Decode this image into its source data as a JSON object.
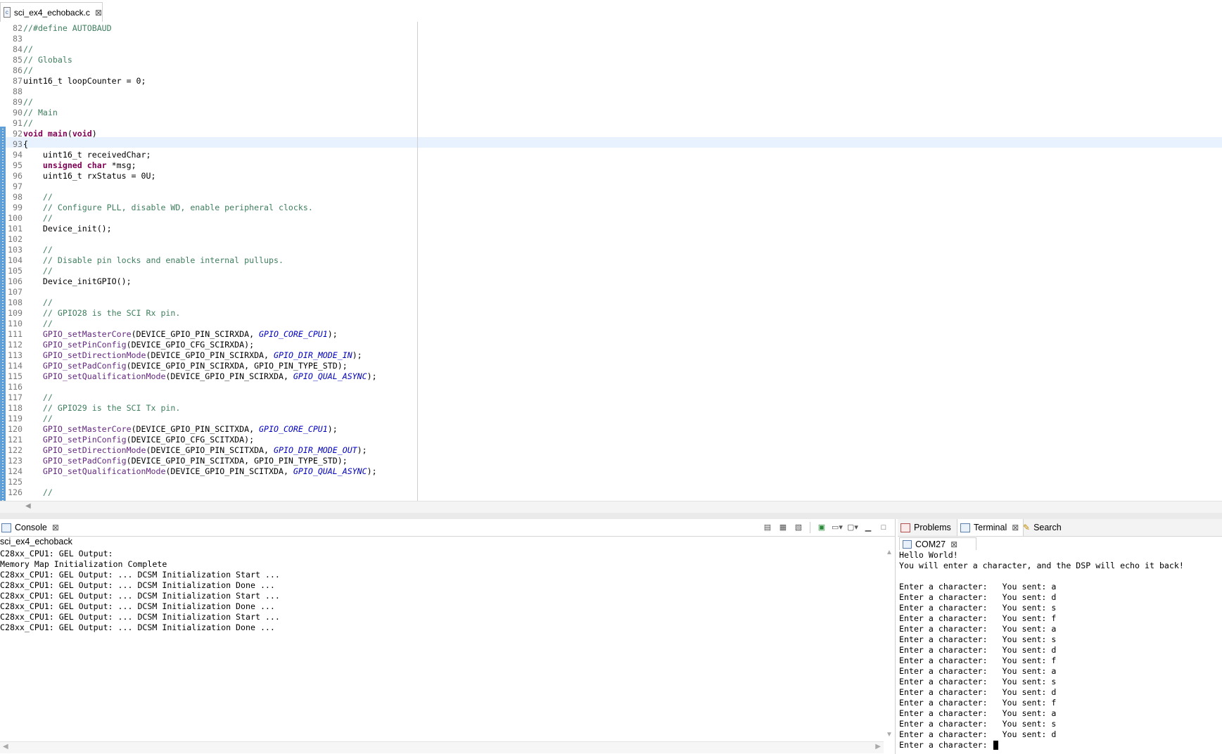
{
  "editor": {
    "tab": {
      "file_icon": "c-file-icon",
      "label": "sci_ex4_echoback.c",
      "close_glyph": "⊠"
    },
    "lines": [
      {
        "n": "82",
        "segs": [
          [
            "cm",
            "//#define AUTOBAUD"
          ]
        ]
      },
      {
        "n": "83",
        "segs": []
      },
      {
        "n": "84",
        "segs": [
          [
            "cm",
            "//"
          ]
        ]
      },
      {
        "n": "85",
        "segs": [
          [
            "cm",
            "// Globals"
          ]
        ]
      },
      {
        "n": "86",
        "segs": [
          [
            "cm",
            "//"
          ]
        ]
      },
      {
        "n": "87",
        "segs": [
          [
            "",
            "uint16_t loopCounter = 0;"
          ]
        ]
      },
      {
        "n": "88",
        "segs": []
      },
      {
        "n": "89",
        "segs": [
          [
            "cm",
            "//"
          ]
        ]
      },
      {
        "n": "90",
        "segs": [
          [
            "cm",
            "// Main"
          ]
        ]
      },
      {
        "n": "91",
        "segs": [
          [
            "cm",
            "//"
          ]
        ]
      },
      {
        "n": "92",
        "segs": [
          [
            "kw",
            "void"
          ],
          [
            "",
            " "
          ],
          [
            "kw",
            "main"
          ],
          [
            "",
            "("
          ],
          [
            "kw",
            "void"
          ],
          [
            "",
            ")"
          ]
        ]
      },
      {
        "n": "93",
        "segs": [
          [
            "",
            "{"
          ]
        ]
      },
      {
        "n": "94",
        "segs": [
          [
            "",
            "    uint16_t receivedChar;"
          ]
        ]
      },
      {
        "n": "95",
        "segs": [
          [
            "",
            "    "
          ],
          [
            "kw",
            "unsigned char"
          ],
          [
            "",
            " *msg;"
          ]
        ]
      },
      {
        "n": "96",
        "segs": [
          [
            "",
            "    uint16_t rxStatus = 0U;"
          ]
        ]
      },
      {
        "n": "97",
        "segs": []
      },
      {
        "n": "98",
        "segs": [
          [
            "",
            "    "
          ],
          [
            "cm",
            "//"
          ]
        ]
      },
      {
        "n": "99",
        "segs": [
          [
            "",
            "    "
          ],
          [
            "cm",
            "// Configure PLL, disable WD, enable peripheral clocks."
          ]
        ]
      },
      {
        "n": "100",
        "segs": [
          [
            "",
            "    "
          ],
          [
            "cm",
            "//"
          ]
        ]
      },
      {
        "n": "101",
        "segs": [
          [
            "",
            "    Device_init();"
          ]
        ]
      },
      {
        "n": "102",
        "segs": []
      },
      {
        "n": "103",
        "segs": [
          [
            "",
            "    "
          ],
          [
            "cm",
            "//"
          ]
        ]
      },
      {
        "n": "104",
        "segs": [
          [
            "",
            "    "
          ],
          [
            "cm",
            "// Disable pin locks and enable internal pullups."
          ]
        ]
      },
      {
        "n": "105",
        "segs": [
          [
            "",
            "    "
          ],
          [
            "cm",
            "//"
          ]
        ]
      },
      {
        "n": "106",
        "segs": [
          [
            "",
            "    Device_initGPIO();"
          ]
        ]
      },
      {
        "n": "107",
        "segs": []
      },
      {
        "n": "108",
        "segs": [
          [
            "",
            "    "
          ],
          [
            "cm",
            "//"
          ]
        ]
      },
      {
        "n": "109",
        "segs": [
          [
            "",
            "    "
          ],
          [
            "cm",
            "// GPIO28 is the SCI Rx pin."
          ]
        ]
      },
      {
        "n": "110",
        "segs": [
          [
            "",
            "    "
          ],
          [
            "cm",
            "//"
          ]
        ]
      },
      {
        "n": "111",
        "segs": [
          [
            "",
            "    "
          ],
          [
            "fn",
            "GPIO_setMasterCore"
          ],
          [
            "",
            "(DEVICE_GPIO_PIN_SCIRXDA, "
          ],
          [
            "en",
            "GPIO_CORE_CPU1"
          ],
          [
            "",
            ");"
          ]
        ]
      },
      {
        "n": "112",
        "segs": [
          [
            "",
            "    "
          ],
          [
            "fn",
            "GPIO_setPinConfig"
          ],
          [
            "",
            "(DEVICE_GPIO_CFG_SCIRXDA);"
          ]
        ]
      },
      {
        "n": "113",
        "segs": [
          [
            "",
            "    "
          ],
          [
            "fn",
            "GPIO_setDirectionMode"
          ],
          [
            "",
            "(DEVICE_GPIO_PIN_SCIRXDA, "
          ],
          [
            "en",
            "GPIO_DIR_MODE_IN"
          ],
          [
            "",
            ");"
          ]
        ]
      },
      {
        "n": "114",
        "segs": [
          [
            "",
            "    "
          ],
          [
            "fn",
            "GPIO_setPadConfig"
          ],
          [
            "",
            "(DEVICE_GPIO_PIN_SCIRXDA, GPIO_PIN_TYPE_STD);"
          ]
        ]
      },
      {
        "n": "115",
        "segs": [
          [
            "",
            "    "
          ],
          [
            "fn",
            "GPIO_setQualificationMode"
          ],
          [
            "",
            "(DEVICE_GPIO_PIN_SCIRXDA, "
          ],
          [
            "en",
            "GPIO_QUAL_ASYNC"
          ],
          [
            "",
            ");"
          ]
        ]
      },
      {
        "n": "116",
        "segs": []
      },
      {
        "n": "117",
        "segs": [
          [
            "",
            "    "
          ],
          [
            "cm",
            "//"
          ]
        ]
      },
      {
        "n": "118",
        "segs": [
          [
            "",
            "    "
          ],
          [
            "cm",
            "// GPIO29 is the SCI Tx pin."
          ]
        ]
      },
      {
        "n": "119",
        "segs": [
          [
            "",
            "    "
          ],
          [
            "cm",
            "//"
          ]
        ]
      },
      {
        "n": "120",
        "segs": [
          [
            "",
            "    "
          ],
          [
            "fn",
            "GPIO_setMasterCore"
          ],
          [
            "",
            "(DEVICE_GPIO_PIN_SCITXDA, "
          ],
          [
            "en",
            "GPIO_CORE_CPU1"
          ],
          [
            "",
            ");"
          ]
        ]
      },
      {
        "n": "121",
        "segs": [
          [
            "",
            "    "
          ],
          [
            "fn",
            "GPIO_setPinConfig"
          ],
          [
            "",
            "(DEVICE_GPIO_CFG_SCITXDA);"
          ]
        ]
      },
      {
        "n": "122",
        "segs": [
          [
            "",
            "    "
          ],
          [
            "fn",
            "GPIO_setDirectionMode"
          ],
          [
            "",
            "(DEVICE_GPIO_PIN_SCITXDA, "
          ],
          [
            "en",
            "GPIO_DIR_MODE_OUT"
          ],
          [
            "",
            ");"
          ]
        ]
      },
      {
        "n": "123",
        "segs": [
          [
            "",
            "    "
          ],
          [
            "fn",
            "GPIO_setPadConfig"
          ],
          [
            "",
            "(DEVICE_GPIO_PIN_SCITXDA, GPIO_PIN_TYPE_STD);"
          ]
        ]
      },
      {
        "n": "124",
        "segs": [
          [
            "",
            "    "
          ],
          [
            "fn",
            "GPIO_setQualificationMode"
          ],
          [
            "",
            "(DEVICE_GPIO_PIN_SCITXDA, "
          ],
          [
            "en",
            "GPIO_QUAL_ASYNC"
          ],
          [
            "",
            ");"
          ]
        ]
      },
      {
        "n": "125",
        "segs": []
      },
      {
        "n": "126",
        "segs": [
          [
            "",
            "    "
          ],
          [
            "cm",
            "//"
          ]
        ]
      }
    ]
  },
  "console": {
    "tab_label": "Console",
    "tab_icon": "console-icon",
    "close_glyph": "⊠",
    "name": "sci_ex4_echoback",
    "lines": [
      "C28xx_CPU1: GEL Output:",
      "Memory Map Initialization Complete",
      "C28xx_CPU1: GEL Output: ... DCSM Initialization Start ...",
      "C28xx_CPU1: GEL Output: ... DCSM Initialization Done ...",
      "C28xx_CPU1: GEL Output: ... DCSM Initialization Start ...",
      "C28xx_CPU1: GEL Output: ... DCSM Initialization Done ...",
      "C28xx_CPU1: GEL Output: ... DCSM Initialization Start ...",
      "C28xx_CPU1: GEL Output: ... DCSM Initialization Done ..."
    ],
    "toolbar": [
      "clear-console-icon",
      "scroll-lock-icon",
      "word-wrap-icon",
      "pin-console-icon",
      "display-console-icon",
      "open-console-icon",
      "minimize-icon",
      "maximize-icon"
    ]
  },
  "terminal_panel": {
    "tabs": [
      {
        "label": "Problems",
        "icon": "problems-icon"
      },
      {
        "label": "Terminal",
        "icon": "terminal-icon",
        "close_glyph": "⊠"
      },
      {
        "label": "Search",
        "icon": "search-icon"
      }
    ],
    "session": {
      "label": "COM27",
      "icon": "terminal-session-icon",
      "close_glyph": "⊠"
    },
    "lines": [
      "Hello World!",
      "You will enter a character, and the DSP will echo it back!",
      "",
      "Enter a character:   You sent: a",
      "Enter a character:   You sent: d",
      "Enter a character:   You sent: s",
      "Enter a character:   You sent: f",
      "Enter a character:   You sent: a",
      "Enter a character:   You sent: s",
      "Enter a character:   You sent: d",
      "Enter a character:   You sent: f",
      "Enter a character:   You sent: a",
      "Enter a character:   You sent: s",
      "Enter a character:   You sent: d",
      "Enter a character:   You sent: f",
      "Enter a character:   You sent: a",
      "Enter a character:   You sent: s",
      "Enter a character:   You sent: d"
    ],
    "prompt": "Enter a character: "
  }
}
